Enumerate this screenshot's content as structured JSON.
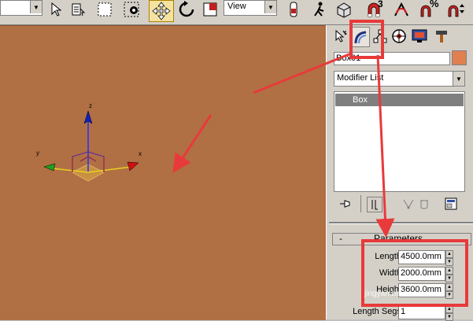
{
  "toolbar": {
    "view_combo": "View",
    "snap_3_label": "3",
    "percent_snap_label": "%"
  },
  "command_panel": {
    "object_name": "Box01",
    "object_color": "#e08050",
    "modifier_list": "Modifier List",
    "stack_items": [
      "Box"
    ],
    "parameters": {
      "rollout_title": "Parameters",
      "length_label": "Length:",
      "length_value": "4500.0mm",
      "width_label": "Width:",
      "width_value": "2000.0mm",
      "height_label": "Height:",
      "height_value": "3600.0mm",
      "length_segs_label": "Length Segs:",
      "length_segs_value": "1"
    }
  },
  "viewport": {
    "background_color": "#b07044",
    "axis_labels": {
      "x": "x",
      "y": "y",
      "z": "z"
    }
  },
  "annotations": {
    "highlight_color": "#e83a3a",
    "watermark": "jingyan.baidu.com"
  }
}
